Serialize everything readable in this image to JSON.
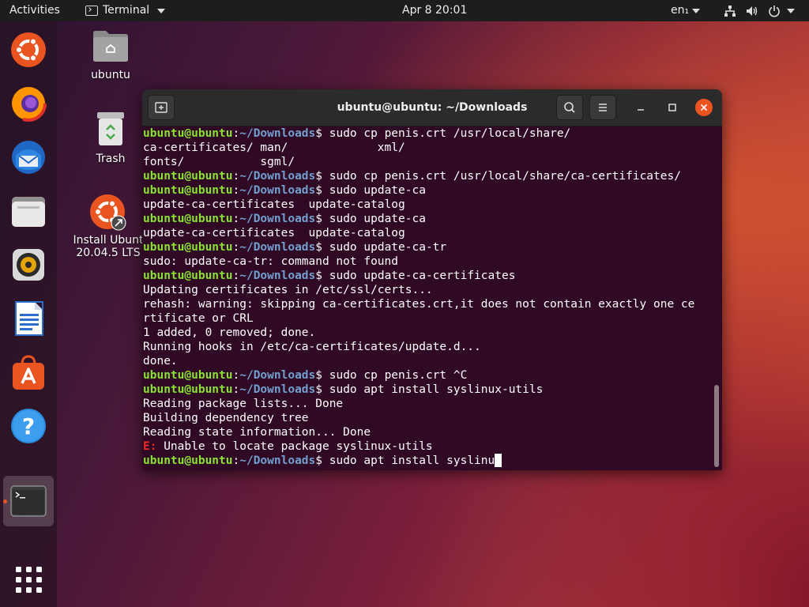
{
  "topbar": {
    "activities": "Activities",
    "app_name": "Terminal",
    "clock": "Apr 8  20:01",
    "language": "en₁"
  },
  "dock": {
    "items": [
      "ubuntu-installer-icon",
      "firefox-icon",
      "thunderbird-icon",
      "files-icon",
      "rhythmbox-icon",
      "libreoffice-writer-icon",
      "software-center-icon",
      "help-icon",
      "terminal-icon",
      "show-apps-icon"
    ]
  },
  "desktop": {
    "home_label": "ubuntu",
    "trash_label": "Trash",
    "installer_label_1": "Install Ubunt",
    "installer_label_2": "20.04.5 LTS"
  },
  "window": {
    "title": "ubuntu@ubuntu: ~/Downloads"
  },
  "terminal": {
    "prompt_user": "ubuntu@ubuntu",
    "prompt_colon": ":",
    "prompt_path": "~/Downloads",
    "prompt_dollar": "$ ",
    "lines": [
      {
        "prompt": true,
        "text": "sudo cp penis.crt /usr/local/share/"
      },
      {
        "text": "ca-certificates/ man/             xml/"
      },
      {
        "text": "fonts/           sgml/"
      },
      {
        "prompt": true,
        "text": "sudo cp penis.crt /usr/local/share/ca-certificates/"
      },
      {
        "prompt": true,
        "text": "sudo update-ca"
      },
      {
        "text": "update-ca-certificates  update-catalog"
      },
      {
        "prompt": true,
        "text": "sudo update-ca"
      },
      {
        "text": "update-ca-certificates  update-catalog"
      },
      {
        "prompt": true,
        "text": "sudo update-ca-tr"
      },
      {
        "text": "sudo: update-ca-tr: command not found"
      },
      {
        "prompt": true,
        "text": "sudo update-ca-certificates"
      },
      {
        "text": "Updating certificates in /etc/ssl/certs..."
      },
      {
        "text": "rehash: warning: skipping ca-certificates.crt,it does not contain exactly one ce"
      },
      {
        "text": "rtificate or CRL"
      },
      {
        "text": "1 added, 0 removed; done."
      },
      {
        "text": "Running hooks in /etc/ca-certificates/update.d..."
      },
      {
        "text": "done."
      },
      {
        "prompt": true,
        "text": "sudo cp penis.crt ^C"
      },
      {
        "prompt": true,
        "text": "sudo apt install syslinux-utils"
      },
      {
        "text": "Reading package lists... Done"
      },
      {
        "text": "Building dependency tree"
      },
      {
        "text": "Reading state information... Done"
      },
      {
        "error_prefix": "E: ",
        "text": "Unable to locate package syslinux-utils"
      },
      {
        "prompt": true,
        "text": "sudo apt install syslinu",
        "cursor": true
      }
    ]
  },
  "colors": {
    "terminal_bg": "#300a24",
    "prompt_user": "#8ae234",
    "prompt_path": "#729fcf",
    "error": "#ef2929",
    "ubuntu_orange": "#e95420"
  }
}
